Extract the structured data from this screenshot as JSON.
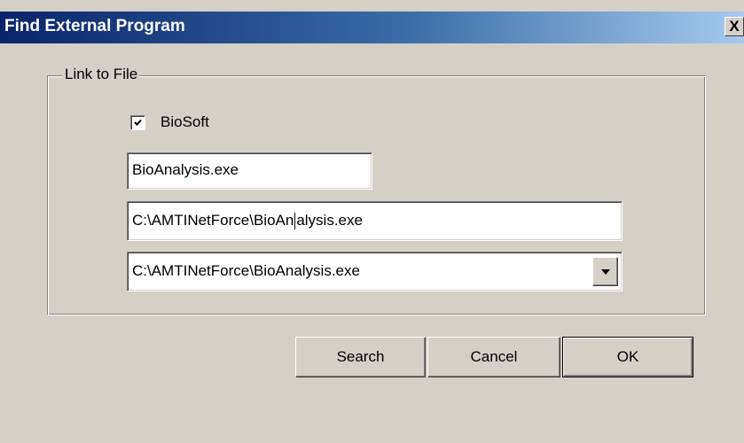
{
  "window": {
    "title": "Find External Program",
    "close_glyph": "X"
  },
  "group": {
    "legend": "Link to File"
  },
  "checkbox": {
    "label": "BioSoft",
    "checked": true
  },
  "fields": {
    "name_value": "BioAnalysis.exe",
    "path_value_before_caret": "C:\\AMTINetForce\\BioAn",
    "path_value_after_caret": "alysis.exe"
  },
  "combo": {
    "selected": "C:\\AMTINetForce\\BioAnalysis.exe"
  },
  "buttons": {
    "search": "Search",
    "cancel": "Cancel",
    "ok": "OK"
  },
  "icons": {
    "close": "close-icon",
    "check": "check-icon",
    "dropdown": "chevron-down-icon"
  }
}
